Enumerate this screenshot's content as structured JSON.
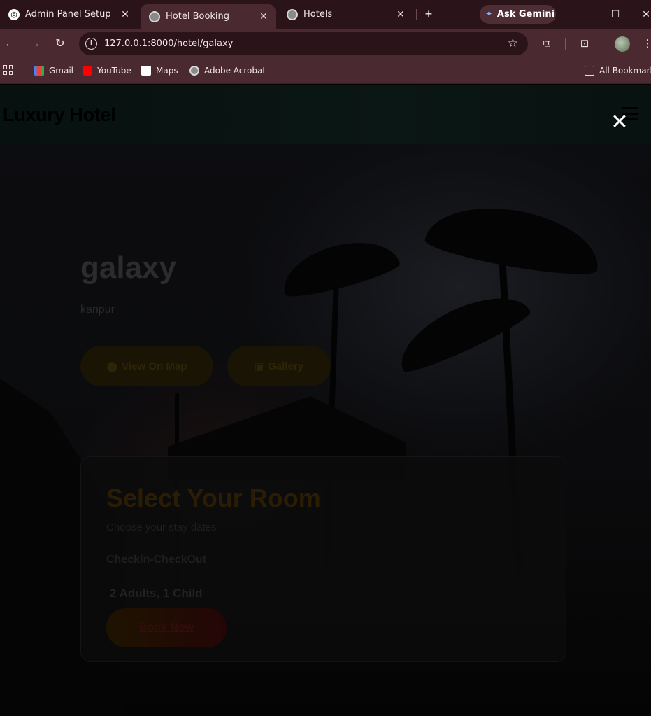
{
  "browser": {
    "tabs": [
      {
        "title": "Admin Panel Setup",
        "icon": "chatgpt-icon"
      },
      {
        "title": "Hotel Booking",
        "icon": "globe-icon",
        "active": true
      },
      {
        "title": "Hotels",
        "icon": "globe-icon"
      }
    ],
    "new_tab_symbol": "+",
    "gemini_label": "Ask Gemini",
    "url": "127.0.0.1:8000/hotel/galaxy",
    "bookmarks": [
      {
        "label": "Gmail",
        "icon": "gmail-icon"
      },
      {
        "label": "YouTube",
        "icon": "youtube-icon"
      },
      {
        "label": "Maps",
        "icon": "maps-icon"
      },
      {
        "label": "Adobe Acrobat",
        "icon": "globe-icon"
      }
    ],
    "all_bookmarks_label": "All Bookmarks"
  },
  "site": {
    "logo": "Luxury Hotel",
    "close_symbol": "✕"
  },
  "hotel": {
    "name": "galaxy",
    "city": "kanpur",
    "map_button": "View On Map",
    "gallery_button": "Gallery"
  },
  "booking": {
    "title": "Select Your Room",
    "subtitle": "Choose your stay dates",
    "dates_placeholder": "Checkin-CheckOut",
    "guests": "2 Adults, 1 Child",
    "book_button": "Book Now"
  },
  "colors": {
    "tabbar": "#2a1419",
    "toolbar": "#4a2a30",
    "overlay_close": "#ffffff"
  }
}
